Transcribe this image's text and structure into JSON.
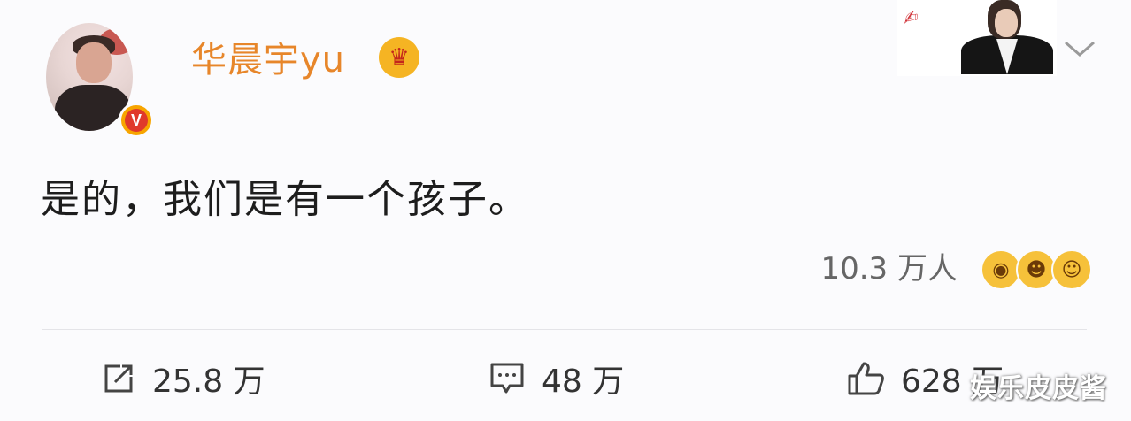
{
  "post": {
    "author": {
      "name": "华晨宇yu",
      "verified_badge": "V"
    },
    "vip_icon": "crown-vip-icon",
    "text": "是的，我们是有一个孩子。",
    "reactions": {
      "count": "10.3 万人",
      "emojis": [
        "surprised-emoji-icon",
        "grinning-emoji-icon",
        "laughing-emoji-icon"
      ]
    },
    "actions": {
      "repost": {
        "count": "25.8 万",
        "icon": "share-icon"
      },
      "comment": {
        "count": "48 万",
        "icon": "comment-icon"
      },
      "like": {
        "count": "628 万",
        "icon": "thumbs-up-icon"
      }
    }
  },
  "colors": {
    "username": "#e7862a",
    "verified_outer": "#f7a500",
    "verified_inner": "#e0392b",
    "background": "#fbfbfd"
  },
  "watermark": "娱乐皮皮酱"
}
